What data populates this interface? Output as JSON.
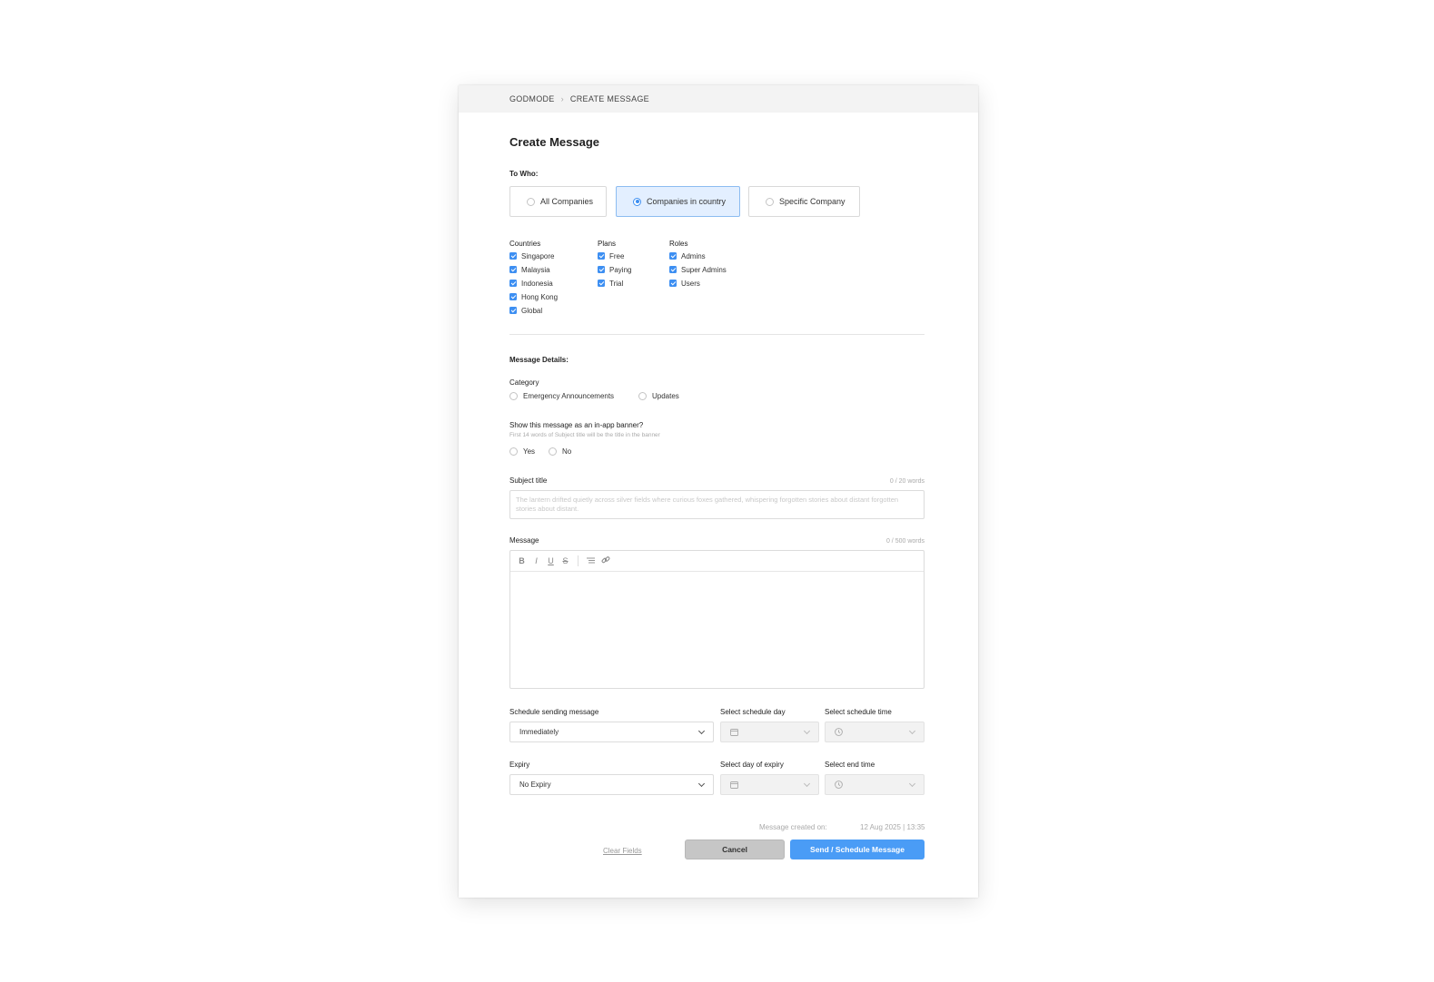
{
  "breadcrumb": {
    "root": "GODMODE",
    "current": "CREATE MESSAGE"
  },
  "title": "Create Message",
  "to_who": {
    "label": "To Who:",
    "options": [
      {
        "label": "All Companies",
        "selected": false
      },
      {
        "label": "Companies in country",
        "selected": true
      },
      {
        "label": "Specific Company",
        "selected": false
      }
    ]
  },
  "filters": {
    "countries": {
      "title": "Countries",
      "items": [
        "Singapore",
        "Malaysia",
        "Indonesia",
        "Hong Kong",
        "Global"
      ]
    },
    "plans": {
      "title": "Plans",
      "items": [
        "Free",
        "Paying",
        "Trial"
      ]
    },
    "roles": {
      "title": "Roles",
      "items": [
        "Admins",
        "Super Admins",
        "Users"
      ]
    }
  },
  "details": {
    "label": "Message Details:",
    "category": {
      "label": "Category",
      "options": [
        "Emergency Announcements",
        "Updates"
      ]
    },
    "banner": {
      "label": "Show this message as an in-app banner?",
      "hint": "First 14 words of Subject title will be the title in the banner",
      "options": [
        "Yes",
        "No"
      ]
    },
    "subject": {
      "label": "Subject title",
      "counter": "0 / 20 words",
      "placeholder": "The lantern drifted quietly across silver fields where curious foxes gathered, whispering forgotten stories about distant forgotten stories about distant."
    },
    "message": {
      "label": "Message",
      "counter": "0 / 500 words",
      "toolbar": [
        "B",
        "I",
        "U",
        "S"
      ]
    }
  },
  "schedule": {
    "label": "Schedule sending message",
    "value": "Immediately",
    "day_label": "Select schedule day",
    "time_label": "Select schedule time"
  },
  "expiry": {
    "label": "Expiry",
    "value": "No Expiry",
    "day_label": "Select day of expiry",
    "time_label": "Select end time"
  },
  "footer": {
    "created_label": "Message created on:",
    "created_value": "12 Aug 2025 | 13:35",
    "clear": "Clear Fields",
    "cancel": "Cancel",
    "send": "Send / Schedule Message"
  },
  "colors": {
    "accent": "#4a9cf6",
    "selected_bg": "#e3efff"
  }
}
